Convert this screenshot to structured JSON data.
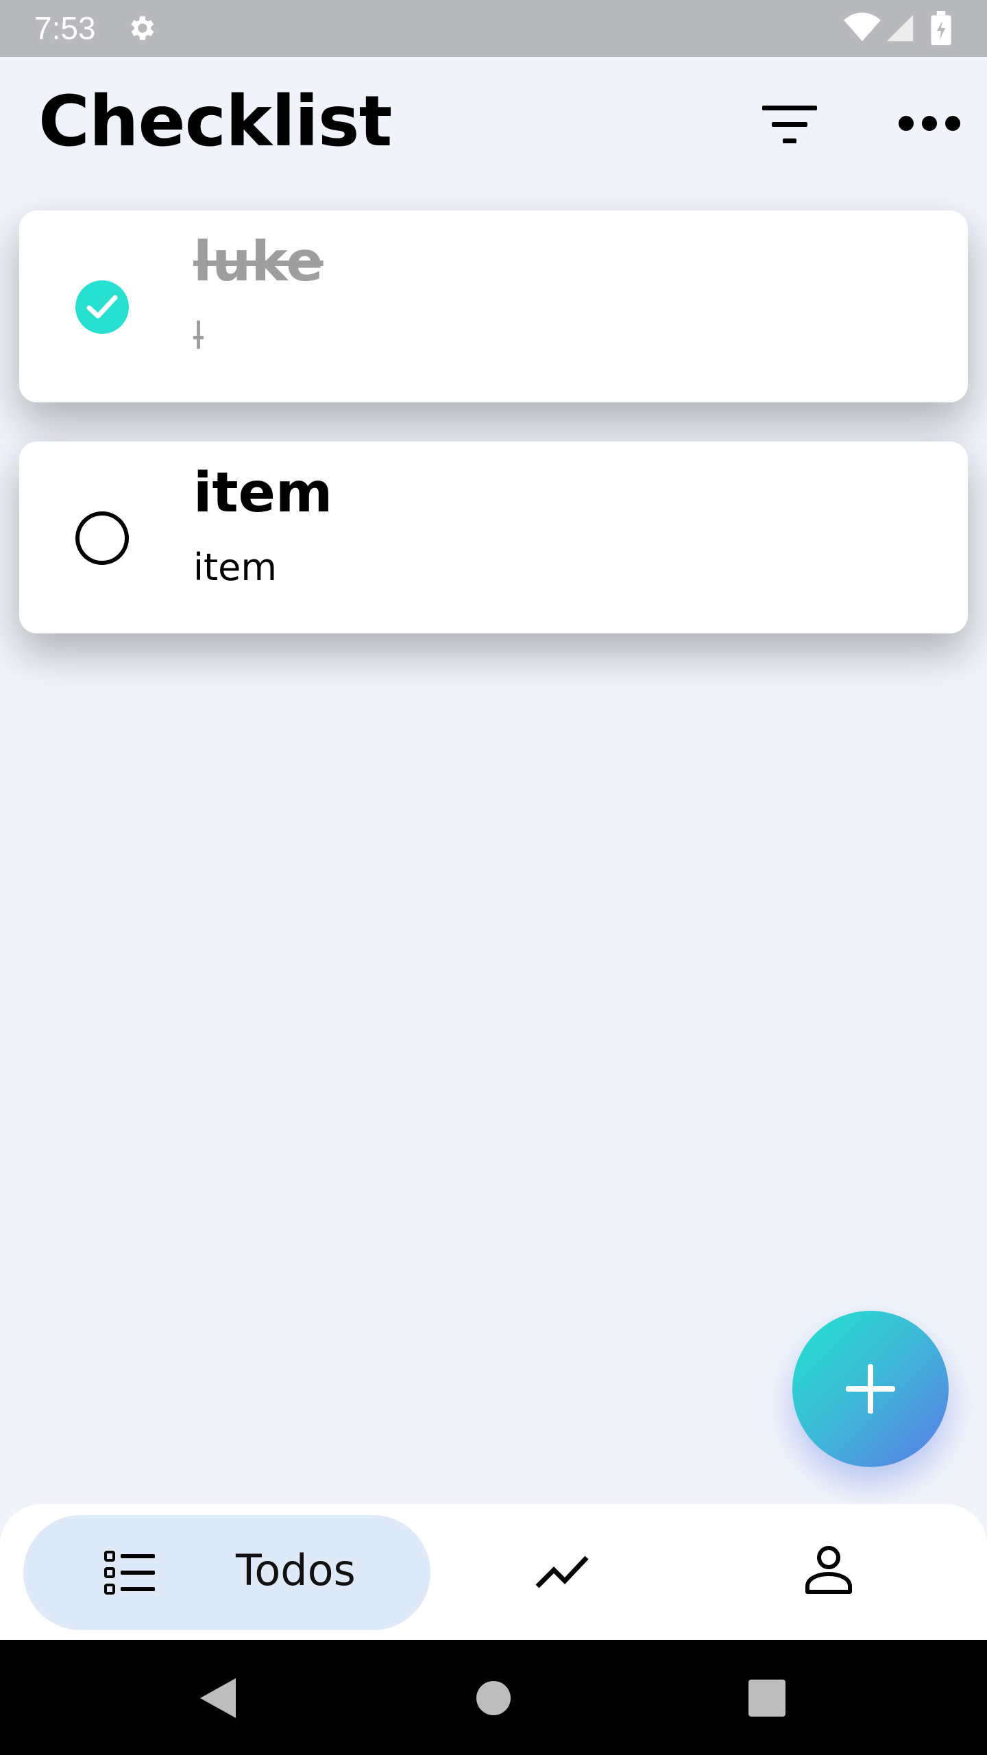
{
  "status_bar": {
    "time": "7:53",
    "icons": [
      "gear-icon",
      "wifi-icon",
      "signal-icon",
      "battery-charging-icon"
    ]
  },
  "header": {
    "title": "Checklist",
    "actions": [
      "filter-icon",
      "more-horizontal-icon"
    ]
  },
  "todos": [
    {
      "title": "luke",
      "description": "l",
      "completed": true
    },
    {
      "title": "item",
      "description": "item",
      "completed": false
    }
  ],
  "fab": {
    "icon": "plus-icon"
  },
  "bottom_nav": {
    "items": [
      {
        "label": "Todos",
        "icon": "list-icon",
        "active": true
      },
      {
        "label": "",
        "icon": "trending-icon",
        "active": false
      },
      {
        "label": "",
        "icon": "person-icon",
        "active": false
      }
    ]
  },
  "system_nav": {
    "icons": [
      "back-icon",
      "home-icon",
      "recents-icon"
    ]
  },
  "colors": {
    "accent_teal": "#27e0d0",
    "fab_gradient_start": "#20e3cf",
    "fab_gradient_end": "#5a7ae6",
    "background": "#f0f4fa",
    "nav_active_bg": "#deeaf8"
  }
}
